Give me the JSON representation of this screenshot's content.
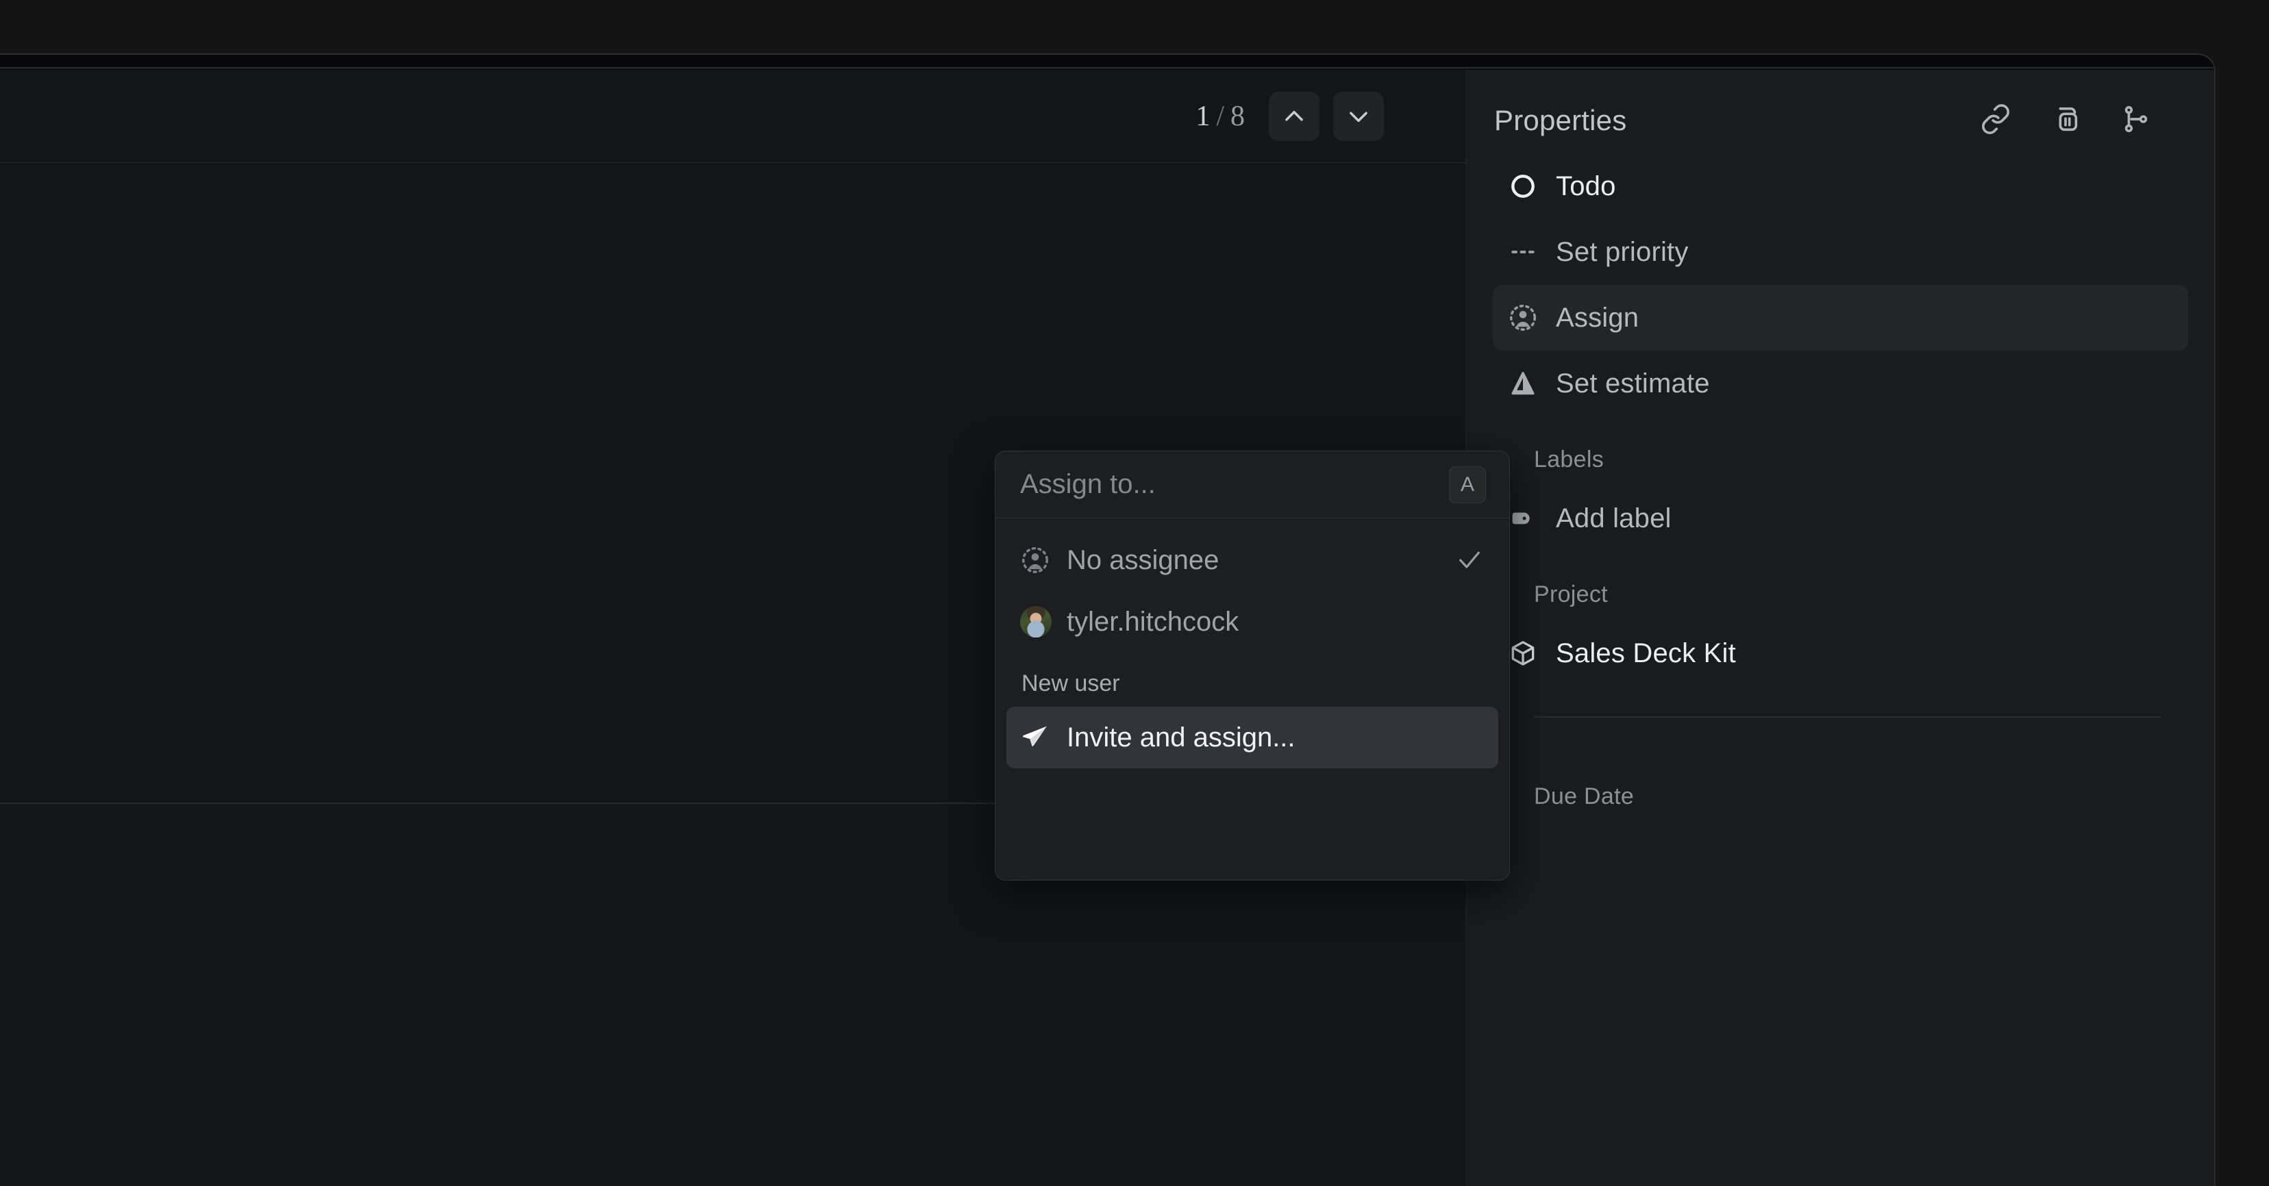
{
  "toolbar": {
    "pager": {
      "current": "1",
      "separator": "/",
      "total": "8"
    },
    "prev_button": "prev-issue",
    "next_button": "next-issue"
  },
  "properties_panel": {
    "title": "Properties",
    "header_icons": [
      {
        "name": "link-icon",
        "label": "Copy link"
      },
      {
        "name": "copy-id-icon",
        "label": "Copy ID"
      },
      {
        "name": "git-branch-icon",
        "label": "Copy branch name"
      }
    ],
    "rows": [
      {
        "icon": "status-todo-icon",
        "label": "Todo",
        "selected": false,
        "tone": "bright"
      },
      {
        "icon": "priority-none-icon",
        "label": "Set priority",
        "selected": false,
        "tone": "dim"
      },
      {
        "icon": "assignee-icon",
        "label": "Assign",
        "selected": true,
        "tone": "dim"
      },
      {
        "icon": "estimate-icon",
        "label": "Set estimate",
        "selected": false,
        "tone": "dim"
      }
    ],
    "labels_section": {
      "title": "Labels",
      "add_label": {
        "icon": "tag-icon",
        "label": "Add label"
      }
    },
    "project_section": {
      "title": "Project",
      "project": {
        "icon": "cube-icon",
        "label": "Sales Deck Kit"
      }
    },
    "due_date_section": {
      "title": "Due Date"
    }
  },
  "assign_popup": {
    "search": {
      "placeholder": "Assign to...",
      "value": ""
    },
    "shortcut_badge": "A",
    "options": [
      {
        "icon": "assignee-icon",
        "label": "No assignee",
        "checked": true,
        "highlight": false
      },
      {
        "icon": "user-avatar",
        "label": "tyler.hitchcock",
        "checked": false,
        "highlight": false
      }
    ],
    "new_user_section": {
      "title": "New user",
      "action": {
        "icon": "send-icon",
        "label": "Invite and assign...",
        "highlight": true
      }
    }
  },
  "colors": {
    "app_background": "#141414",
    "window_background": "#0d0d0d",
    "main_background": "#141518",
    "panel_background": "#1a1b1e",
    "popup_background": "#1d1e21",
    "selected_row": "#232528",
    "highlight_row": "#32343b",
    "divider": "#26282c",
    "text_bright": "#eceef1",
    "text_dim": "#8d9095"
  }
}
